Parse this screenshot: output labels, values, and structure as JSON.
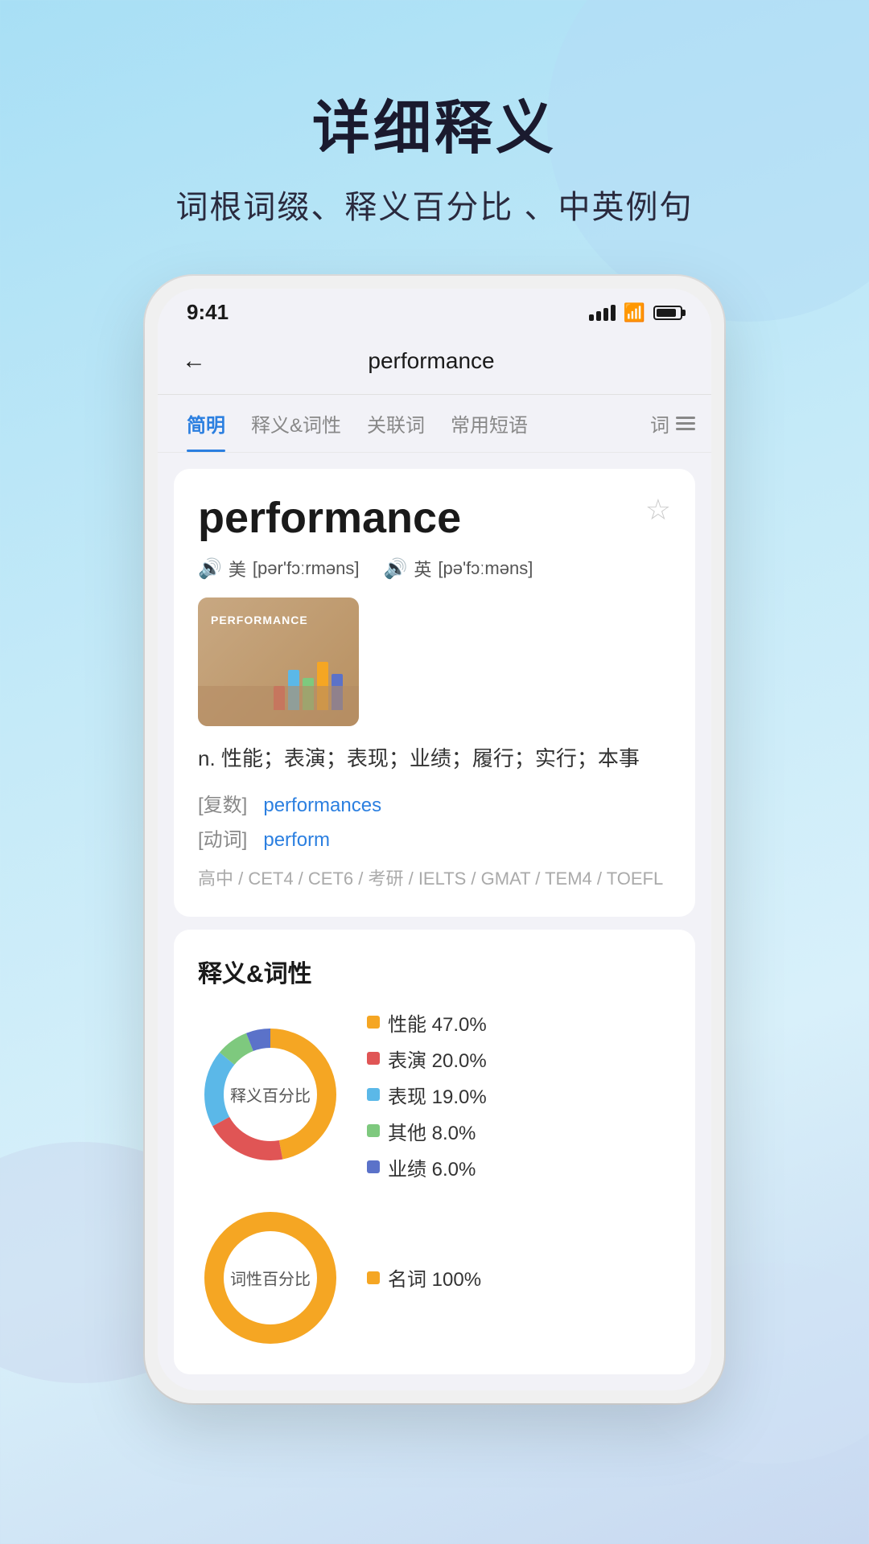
{
  "header": {
    "title": "详细释义",
    "subtitle": "词根词缀、释义百分比 、中英例句"
  },
  "phone": {
    "status": {
      "time": "9:41"
    },
    "nav": {
      "back_label": "←",
      "title": "performance"
    },
    "tabs": [
      {
        "id": "jianjian",
        "label": "简明",
        "active": true
      },
      {
        "id": "yiyi",
        "label": "释义&词性",
        "active": false
      },
      {
        "id": "guanlian",
        "label": "关联词",
        "active": false
      },
      {
        "id": "changyong",
        "label": "常用短语",
        "active": false
      },
      {
        "id": "ci",
        "label": "词",
        "active": false
      }
    ]
  },
  "word_card": {
    "word": "performance",
    "star_label": "☆",
    "pronunciations": [
      {
        "flag": "美",
        "phonetic": "[pər'fɔːrməns]"
      },
      {
        "flag": "英",
        "phonetic": "[pə'fɔːməns]"
      }
    ],
    "image_label": "PERFORMANCE",
    "definition": "n.  性能；表演；表现；业绩；履行；实行；本事",
    "forms": [
      {
        "bracket": "[复数]",
        "link": "performances"
      },
      {
        "bracket": "[动词]",
        "link": "perform"
      }
    ],
    "exam_tags": "高中 / CET4 / CET6 / 考研 / IELTS / GMAT / TEM4 / TOEFL"
  },
  "definition_section": {
    "title": "释义&词性",
    "donut1": {
      "label": "释义百分比",
      "segments": [
        {
          "label": "性能",
          "percent": 47.0,
          "color": "#F5A623"
        },
        {
          "label": "表演",
          "percent": 20.0,
          "color": "#E05555"
        },
        {
          "label": "表现",
          "percent": 19.0,
          "color": "#5BB8E8"
        },
        {
          "label": "其他",
          "percent": 8.0,
          "color": "#7EC97E"
        },
        {
          "label": "业绩",
          "percent": 6.0,
          "color": "#5B72C9"
        }
      ]
    },
    "donut2": {
      "label": "词性百分比",
      "segments": [
        {
          "label": "名词",
          "percent": 100.0,
          "color": "#F5A623"
        }
      ]
    }
  }
}
